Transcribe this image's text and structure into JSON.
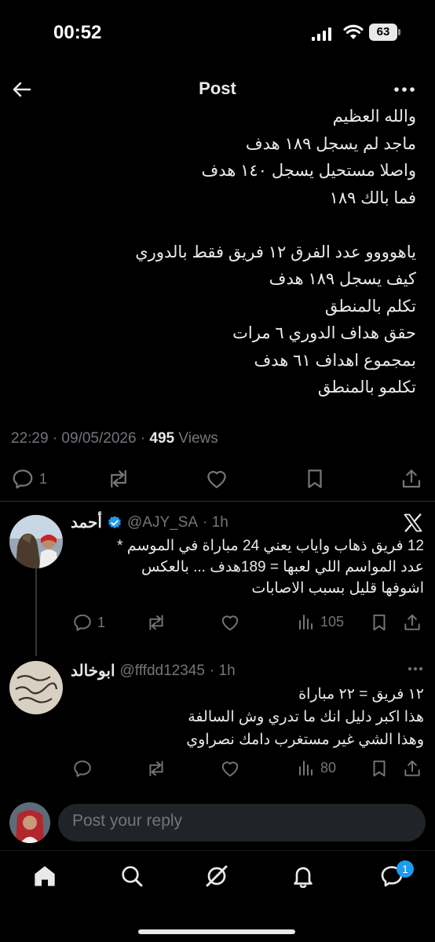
{
  "status_bar": {
    "time": "00:52",
    "battery": "63"
  },
  "header": {
    "title": "Post"
  },
  "post": {
    "text_lines": [
      "والله العظيم",
      "ماجد لم يسجل ١٨٩ هدف",
      "واصلا مستحيل يسجل ١٤٠ هدف",
      "فما بالك ١٨٩",
      "",
      "ياهوووو عدد الفرق ١٢ فريق فقط بالدوري",
      "كيف يسجل ١٨٩ هدف",
      "تكلم بالمنطق",
      "حقق هداف الدوري ٦ مرات",
      "بمجموع اهداف ٦١ هدف",
      "تكلمو بالمنطق"
    ],
    "timestamp": "22:29 · 09/05/2026 · ",
    "views_count": "495",
    "views_label": " Views",
    "reply_count": "1"
  },
  "replies": [
    {
      "name": "أحمد",
      "handle": "@AJY_SA",
      "time": "· 1h",
      "text": "12 فريق ذهاب واياب يعني 24 مباراة في الموسم *\nعدد المواسم اللي لعبها = 189هدف ... بالعكس\nاشوفها قليل بسبب الاصابات",
      "reply_count": "1",
      "views": "105"
    },
    {
      "name": "ابوخالد",
      "handle": "@fffdd12345",
      "time": "· 1h",
      "text": "١٢ فريق = ٢٢ مباراة\nهذا اكبر دليل انك ما تدري وش السالفة\nوهذا الشي غير مستغرب دامك نصراوي",
      "views": "80"
    }
  ],
  "composer": {
    "placeholder": "Post your reply"
  },
  "tabbar": {
    "badge": "1"
  },
  "colors": {
    "background": "#000000",
    "text": "#e7e9ea",
    "muted": "#71767b",
    "verified": "#1d9bf0"
  }
}
